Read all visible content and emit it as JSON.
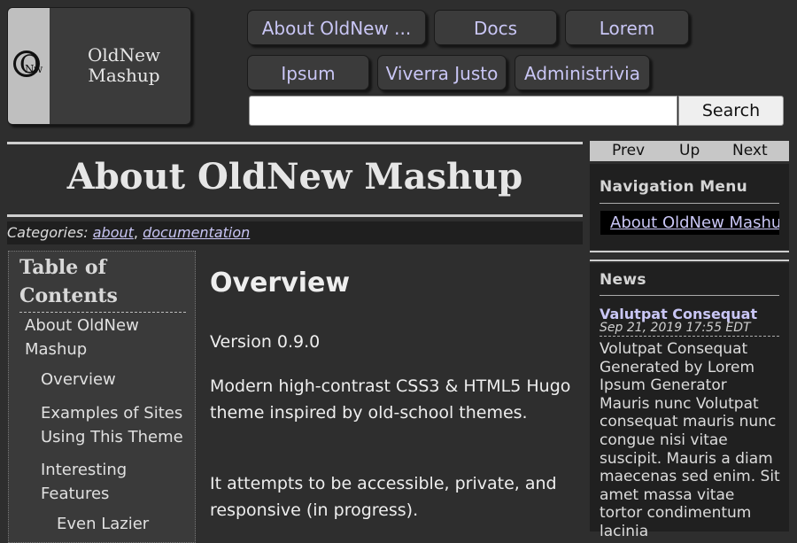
{
  "header": {
    "logo_text": "OldNew Mashup",
    "logo_mark": {
      "o": "O",
      "n": "N",
      "w": "w"
    }
  },
  "nav": {
    "items": [
      "About OldNew ...",
      "Docs",
      "Lorem",
      "Ipsum",
      "Viverra Justo",
      "Administrivia"
    ]
  },
  "search": {
    "placeholder": "",
    "button_label": "Search"
  },
  "page": {
    "title": "About OldNew Mashup",
    "categories_label": "Categories:",
    "categories": [
      "about",
      "documentation"
    ],
    "separator": ","
  },
  "toc": {
    "title": "Table of Contents",
    "items": [
      "About OldNew Mashup",
      "Overview",
      "Examples of Sites Using This Theme",
      "Interesting Features",
      "Even Lazier"
    ]
  },
  "article": {
    "heading": "Overview",
    "paragraphs": [
      "Version 0.9.0",
      "Modern high-contrast CSS3 & HTML5 Hugo theme inspired by old-school themes.",
      "It attempts to be accessible, private, and responsive (in progress)."
    ]
  },
  "sidebar": {
    "pager": {
      "prev": "Prev",
      "up": "Up",
      "next": "Next"
    },
    "nav_menu_title": "Navigation Menu",
    "nav_menu_items": [
      "About OldNew Mashup"
    ],
    "news_title": "News",
    "news": {
      "title": "Valutpat Consequat",
      "date": "Sep 21, 2019 17:55 EDT",
      "body": "Volutpat Consequat Generated by Lorem Ipsum Generator Mauris nunc Volutpat consequat mauris nunc congue nisi vitae suscipit. Mauris a diam maecenas sed enim. Sit amet massa vitae tortor condimentum lacinia"
    }
  },
  "colors": {
    "background": "#2e2e2e",
    "panel": "#3b3b3b",
    "link": "#c9c6f5",
    "text": "#eeeeee"
  }
}
